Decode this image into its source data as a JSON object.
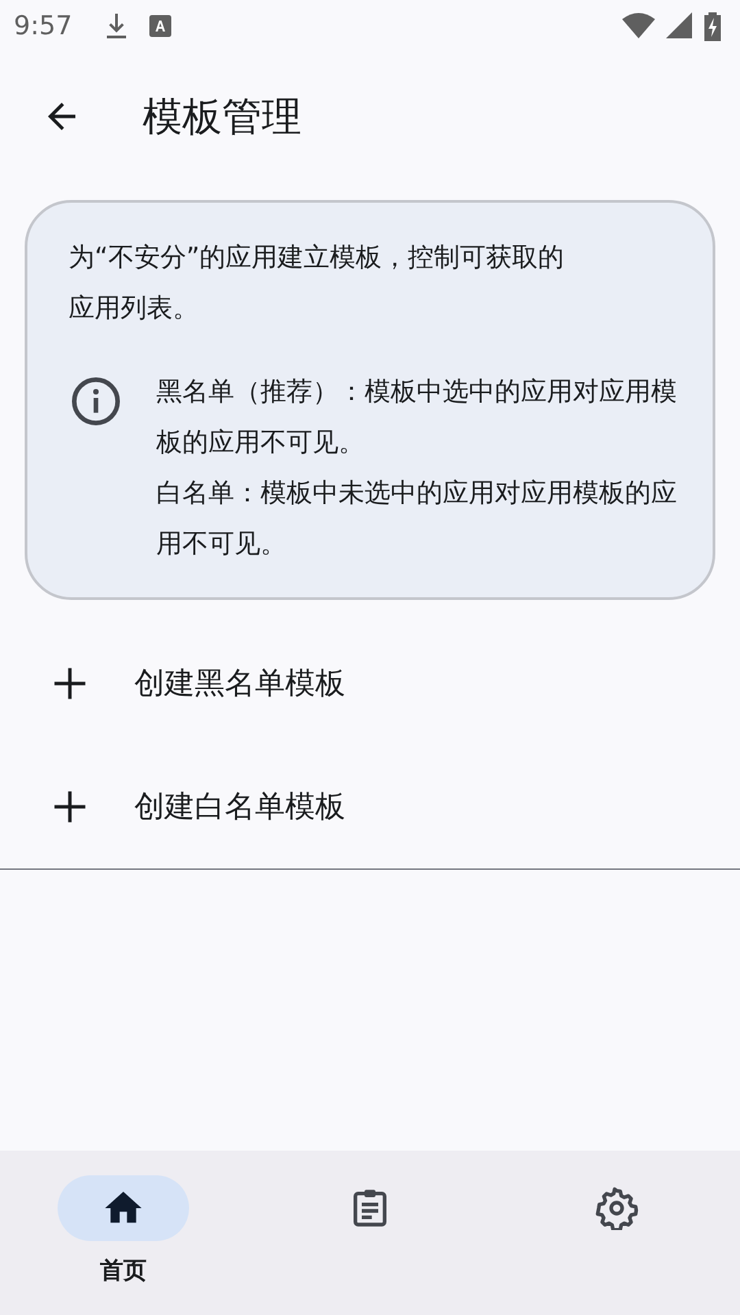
{
  "status_bar": {
    "time": "9:57"
  },
  "app_bar": {
    "title": "模板管理"
  },
  "info_card": {
    "intro": "为“不安分”的应用建立模板，控制可获取的应用列表。",
    "details": [
      "黑名单（推荐）：模板中选中的应用对应用模板的应用不可见。",
      "白名单：模板中未选中的应用对应用模板的应用不可见。"
    ]
  },
  "actions": [
    {
      "label": "创建黑名单模板"
    },
    {
      "label": "创建白名单模板"
    }
  ],
  "bottom_nav": [
    {
      "kind": "home",
      "label": "首页",
      "selected": true
    },
    {
      "kind": "clipboard",
      "selected": false
    },
    {
      "kind": "settings",
      "selected": false
    }
  ]
}
